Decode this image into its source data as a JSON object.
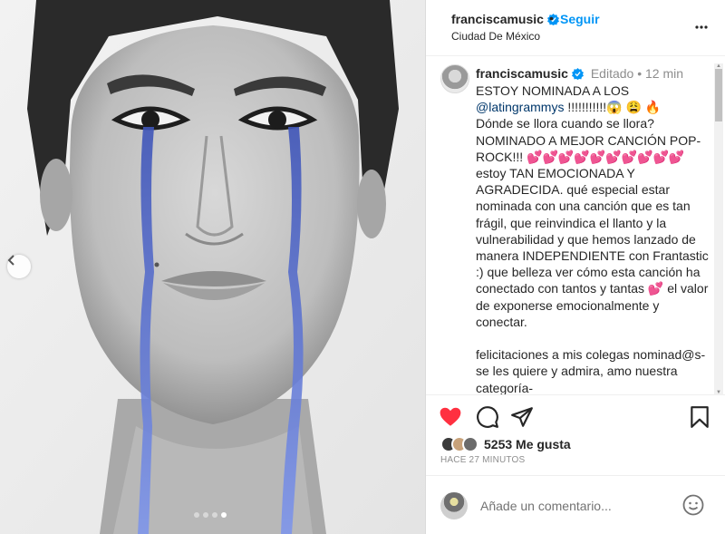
{
  "post": {
    "username": "franciscamusic",
    "follow_label": "Seguir",
    "separator": "•",
    "location": "Ciudad De México",
    "caption_meta": "Editado  •  12 min",
    "caption_line1": "ESTOY NOMINADA A LOS",
    "mention": "@latingrammys",
    "caption_after_mention": " !!!!!!!!!!!😱 😩 🔥",
    "caption_body": "Dónde se llora cuando se llora?\nNOMINADO A MEJOR CANCIÓN POP-ROCK!!! 💕💕💕💕💕💕💕💕💕💕 estoy TAN EMOCIONADA Y AGRADECIDA. qué especial estar nominada con una canción que es tan frágil, que reinvindica el llanto y la vulnerabilidad y que hemos lanzado de manera INDEPENDIENTE con Frantastic :) que belleza ver cómo esta canción ha conectado con tantos y tantas 💕 el valor de exponerse emocionalmente y conectar.\n\nfelicitaciones a mis colegas nominad@s- se les quiere y admira, amo nuestra categoría-",
    "likes": "5253 Me gusta",
    "time": "HACE 27 MINUTOS",
    "comment_placeholder": "Añade un comentario...",
    "carousel": {
      "slides": 4,
      "active_index": 3
    }
  },
  "icons": {
    "heart": "heart-icon",
    "comment": "comment-icon",
    "share": "paper-plane-icon",
    "save": "bookmark-icon",
    "emoji": "emoji-icon",
    "more": "more-options-icon",
    "verified": "verified-badge-icon",
    "prev": "chevron-left-icon"
  },
  "colors": {
    "accent": "#0095f6",
    "like": "#ff3040",
    "tears": "#5a73d6",
    "verified": "#0095f6"
  }
}
